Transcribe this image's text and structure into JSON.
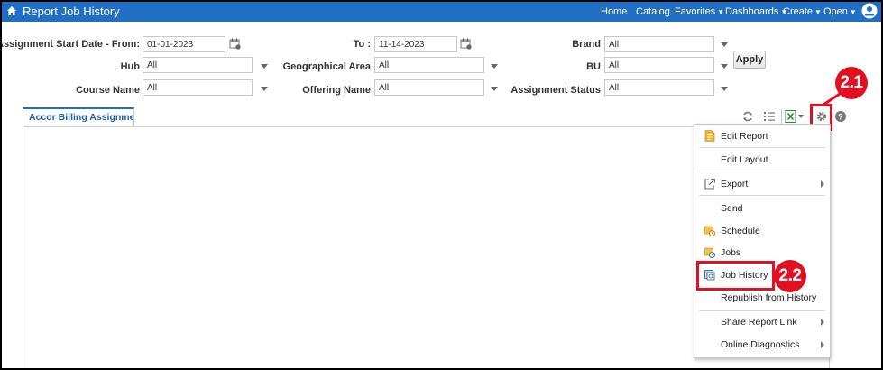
{
  "header": {
    "title": "Report Job History",
    "nav": [
      {
        "label": "Home",
        "caret": false
      },
      {
        "label": "Catalog",
        "caret": false
      },
      {
        "label": "Favorites",
        "caret": true
      },
      {
        "label": "Dashboards",
        "caret": true
      },
      {
        "label": "Create",
        "caret": true
      },
      {
        "label": "Open",
        "caret": true
      }
    ]
  },
  "filters": {
    "start_from_label": "Assignment Start Date - From:",
    "start_from_value": "01-01-2023",
    "to_label": "To :",
    "to_value": "11-14-2023",
    "brand_label": "Brand",
    "brand_value": "All",
    "hub_label": "Hub",
    "hub_value": "All",
    "geo_label": "Geographical Area",
    "geo_value": "All",
    "bu_label": "BU",
    "bu_value": "All",
    "course_label": "Course Name",
    "course_value": "All",
    "offering_label": "Offering Name",
    "offering_value": "All",
    "status_label": "Assignment Status",
    "status_value": "All",
    "apply_label": "Apply"
  },
  "tab": {
    "label": "Accor Billing Assignmen..."
  },
  "menu": {
    "items": [
      {
        "label": "Edit Report",
        "icon": "edit-report-icon",
        "submenu": false
      },
      {
        "label": "Edit Layout",
        "icon": "",
        "submenu": false
      },
      {
        "label": "Export",
        "icon": "export-icon",
        "submenu": true
      },
      {
        "label": "Send",
        "icon": "",
        "submenu": false
      },
      {
        "label": "Schedule",
        "icon": "schedule-icon",
        "submenu": false
      },
      {
        "label": "Jobs",
        "icon": "jobs-icon",
        "submenu": false
      },
      {
        "label": "Job History",
        "icon": "job-history-icon",
        "submenu": false
      },
      {
        "label": "Republish from History",
        "icon": "",
        "submenu": false
      },
      {
        "label": "Share Report Link",
        "icon": "",
        "submenu": true
      },
      {
        "label": "Online Diagnostics",
        "icon": "",
        "submenu": true
      }
    ]
  },
  "annotations": {
    "callout_1": "2.1",
    "callout_2": "2.2"
  },
  "colors": {
    "header_bg": "#1f6fc4",
    "annotation_red": "#e01020"
  }
}
